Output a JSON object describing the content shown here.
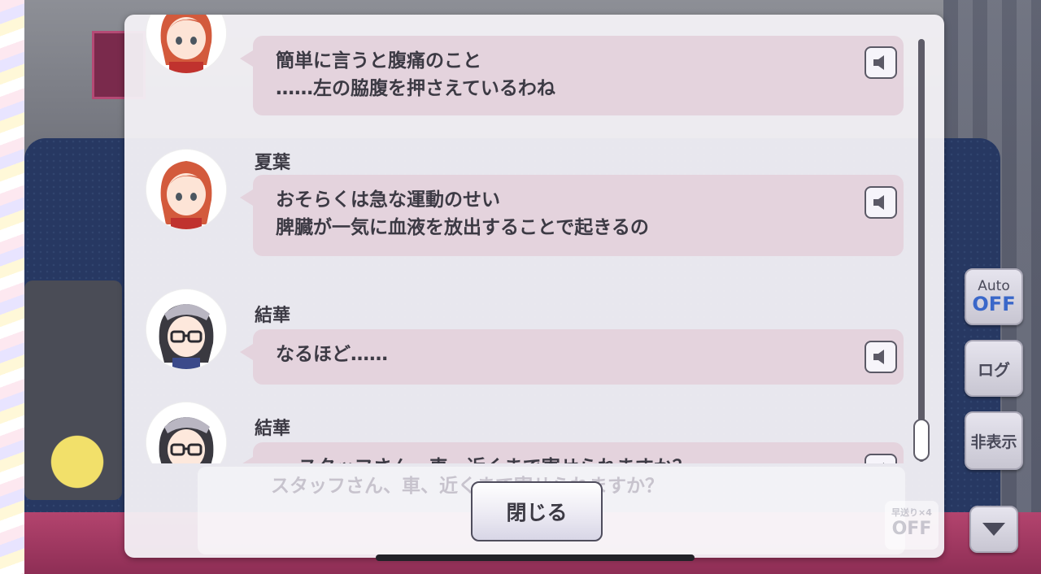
{
  "log": {
    "entries": [
      {
        "speaker": "",
        "avatar": "orange-haired-girl-avatar",
        "lines": [
          "簡単に言うと腹痛のこと",
          "……左の脇腹を押さえているわね"
        ]
      },
      {
        "speaker": "夏葉",
        "avatar": "orange-haired-girl-avatar",
        "lines": [
          "おそらくは急な運動のせい",
          "脾臓が一気に血液を放出することで起きるの"
        ]
      },
      {
        "speaker": "結華",
        "avatar": "glasses-girl-avatar",
        "lines": [
          "なるほど……"
        ]
      },
      {
        "speaker": "結華",
        "avatar": "glasses-girl-avatar",
        "lines": [
          "──スタッフさん、車、近くまで寄せられますか？"
        ]
      }
    ],
    "close_label": "閉じる",
    "ghost_text": "スタッフさん、車、近くまで寄せられますか？"
  },
  "controls": {
    "auto_label": "Auto",
    "auto_state": "OFF",
    "log_label": "ログ",
    "hide_label": "非表示",
    "fast_forward_label": "早送り×4",
    "fast_forward_state": "OFF"
  },
  "colors": {
    "bubble": "#e4d3dd",
    "auto_off": "#3a67c9"
  }
}
